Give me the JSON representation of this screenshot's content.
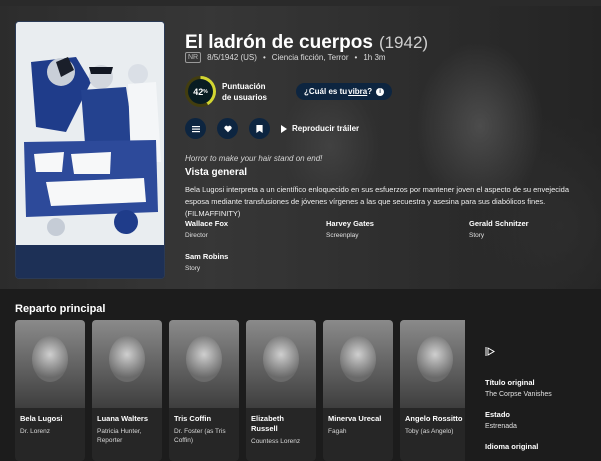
{
  "movie": {
    "title": "El ladrón de cuerpos",
    "year": "(1942)",
    "certification": "NR",
    "release": "8/5/1942 (US)",
    "genres": "Ciencia ficción, Terror",
    "runtime": "1h 3m"
  },
  "score": {
    "value": "42",
    "percent_symbol": "%",
    "label": "Puntuación de usuarios",
    "fraction": 0.42,
    "ring_color": "#d2d531"
  },
  "vibe": {
    "prefix": "¿Cuál es tu ",
    "link": "vibra",
    "suffix": "?"
  },
  "actions": {
    "list_icon": "list-icon",
    "favorite_icon": "heart-icon",
    "watchlist_icon": "bookmark-icon",
    "trailer_label": "Reproducir tráiler"
  },
  "tagline": "Horror to make your hair stand on end!",
  "overview": {
    "heading": "Vista general",
    "text": "Bela Lugosi interpreta a un científico enloquecido en sus esfuerzos por mantener joven el aspecto de su envejecida esposa mediante transfusiones de jóvenes vírgenes a las que secuestra y asesina para sus diabólicos fines. (FILMAFFINITY)"
  },
  "crew": [
    {
      "name": "Wallace Fox",
      "job": "Director"
    },
    {
      "name": "Harvey Gates",
      "job": "Screenplay"
    },
    {
      "name": "Gerald Schnitzer",
      "job": "Story"
    },
    {
      "name": "Sam Robins",
      "job": "Story"
    }
  ],
  "cast_section": {
    "title": "Reparto principal",
    "cast": [
      {
        "name": "Bela Lugosi",
        "role": "Dr. Lorenz"
      },
      {
        "name": "Luana Walters",
        "role": "Patricia Hunter, Reporter"
      },
      {
        "name": "Tris Coffin",
        "role": "Dr. Foster (as Tris Coffin)"
      },
      {
        "name": "Elizabeth Russell",
        "role": "Countess Lorenz"
      },
      {
        "name": "Minerva Urecal",
        "role": "Fagah"
      },
      {
        "name": "Angelo Rossitto",
        "role": "Toby (as Angelo)"
      }
    ]
  },
  "facts_sidebar": {
    "original_title_label": "Título original",
    "original_title": "The Corpse Vanishes",
    "status_label": "Estado",
    "status": "Estrenada",
    "language_label": "Idioma original"
  },
  "colors": {
    "accent_navy": "#0d2540",
    "score_yellow": "#d2d531"
  }
}
